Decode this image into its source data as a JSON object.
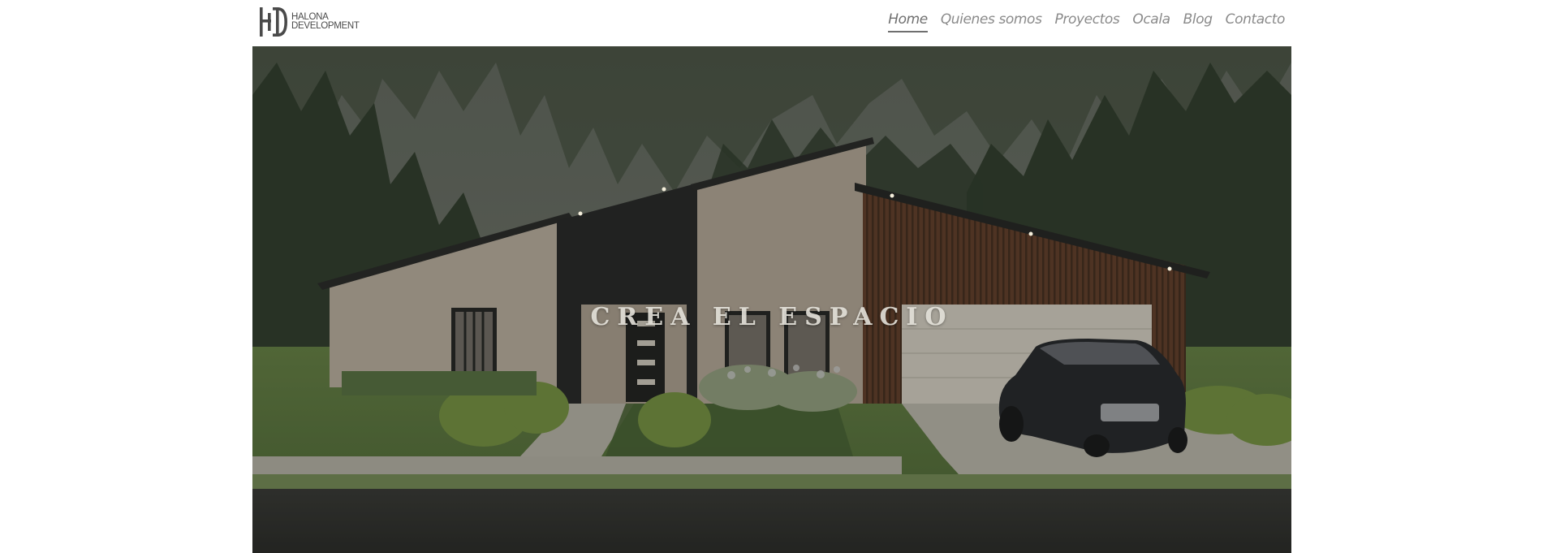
{
  "brand": {
    "line1": "HALONA",
    "line2": "DEVELOPMENT"
  },
  "nav": {
    "items": [
      {
        "label": "Home",
        "active": true
      },
      {
        "label": "Quienes somos",
        "active": false
      },
      {
        "label": "Proyectos",
        "active": false
      },
      {
        "label": "Ocala",
        "active": false
      },
      {
        "label": "Blog",
        "active": false
      },
      {
        "label": "Contacto",
        "active": false
      }
    ]
  },
  "hero": {
    "title": "CREA EL ESPACIO",
    "image": "modern-house-render-with-car"
  },
  "colors": {
    "nav_text": "#8a8a8a",
    "nav_active": "#6f6f6f",
    "overlay": "#2f332c"
  }
}
